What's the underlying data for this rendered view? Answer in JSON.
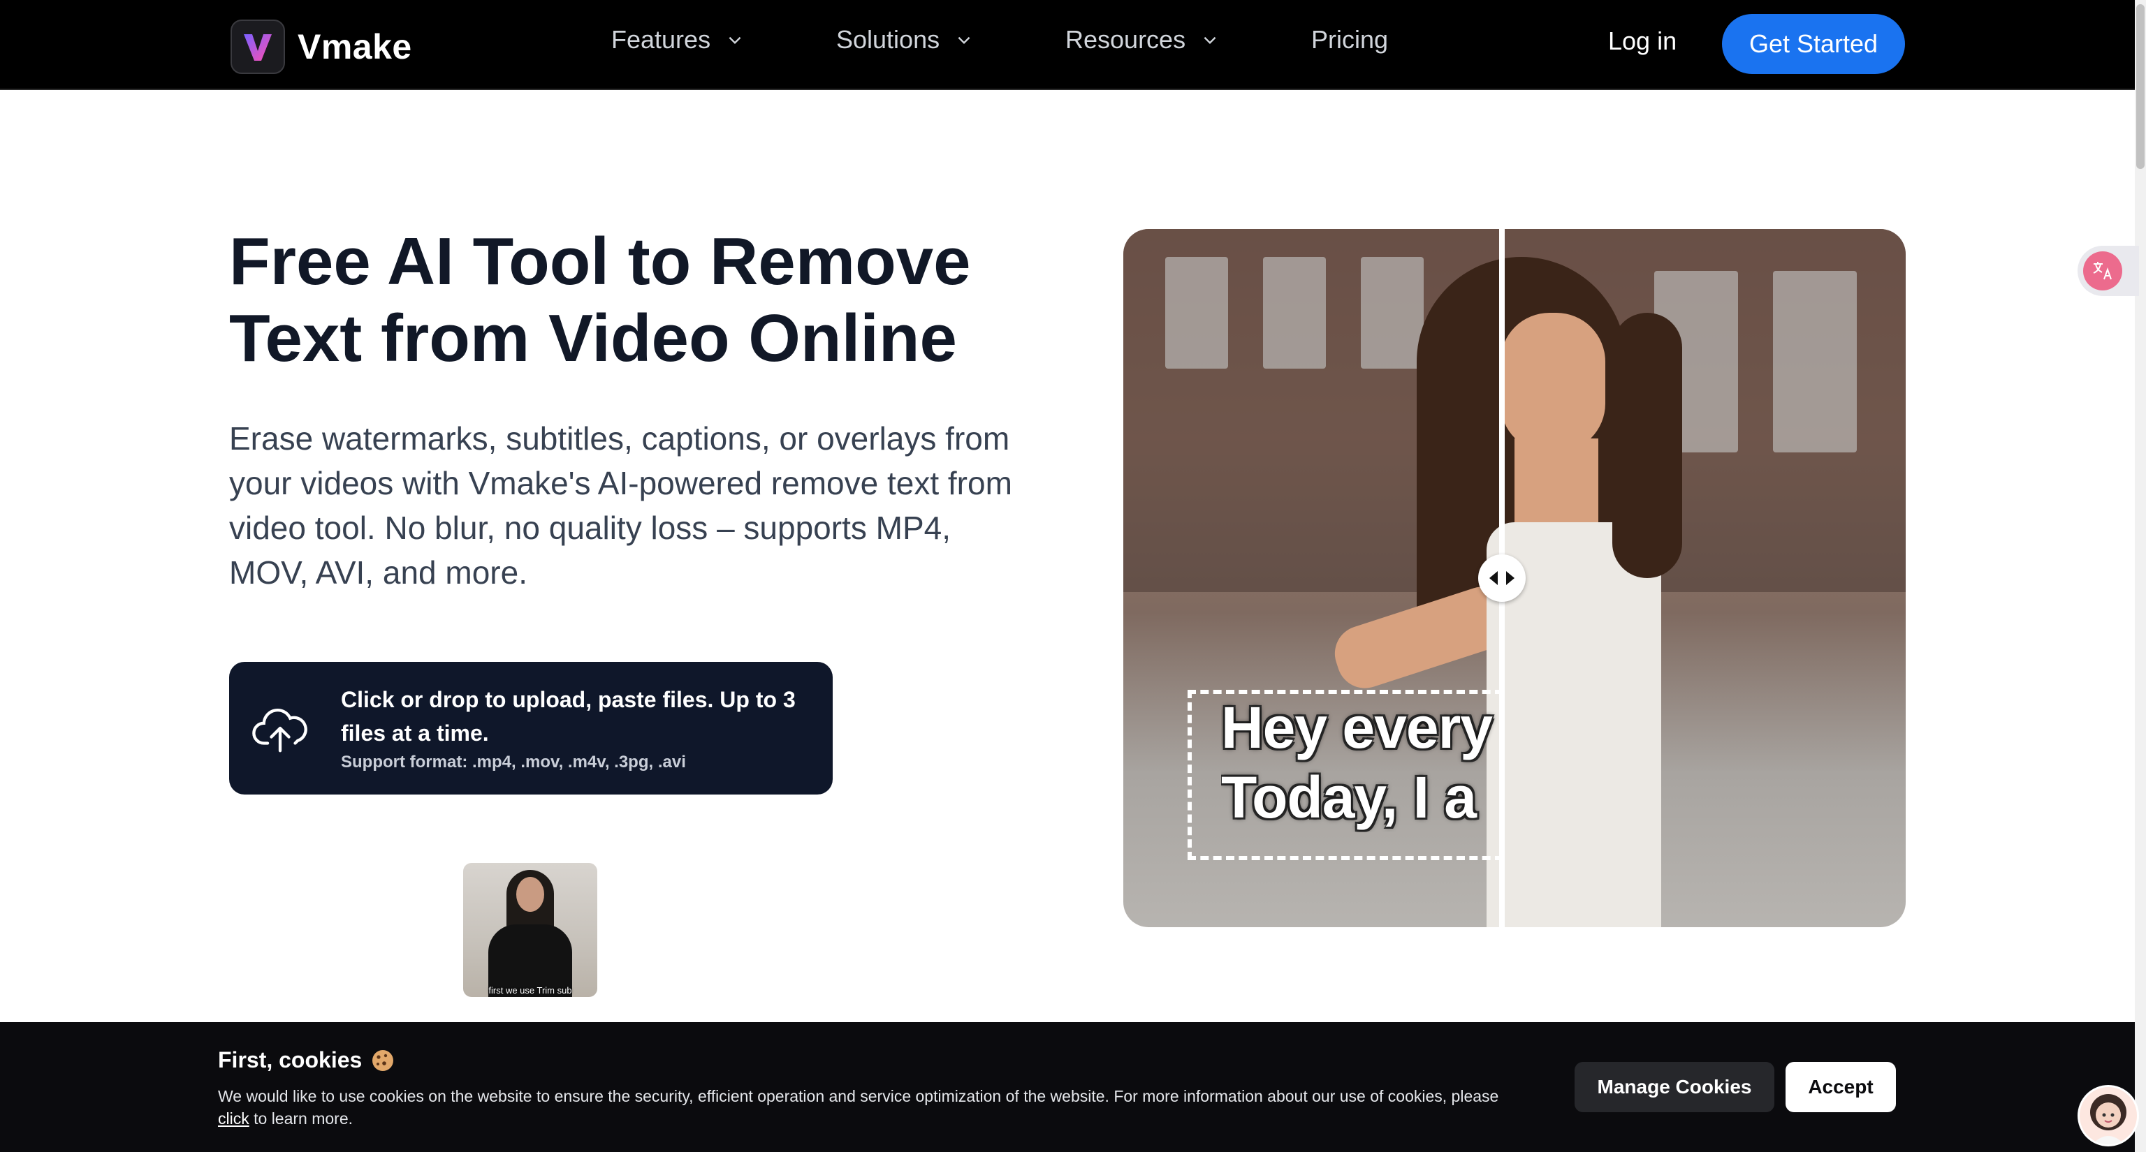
{
  "header": {
    "logo_text": "Vmake",
    "nav": [
      {
        "label": "Features"
      },
      {
        "label": "Solutions"
      },
      {
        "label": "Resources"
      },
      {
        "label": "Pricing"
      }
    ],
    "login_label": "Log in",
    "cta_label": "Get Started"
  },
  "hero": {
    "title": "Free AI Tool to Remove Text from Video Online",
    "description": "Erase watermarks, subtitles, captions, or overlays from your videos with Vmake's AI-powered remove text from video tool. No blur, no quality loss – supports MP4, MOV, AVI, and more.",
    "upload": {
      "main_text": "Click or drop to upload, paste files. Up to 3 files at a time.",
      "formats_text": "Support format: .mp4, .mov, .m4v, .3pg, .avi"
    },
    "sample_caption": "first we use Trim sub"
  },
  "compare": {
    "overlay_line1": "Hey every",
    "overlay_line2": "Today, I a"
  },
  "cookie": {
    "title": "First, cookies",
    "text_before_link": "We would like to use cookies on the website to ensure the security, efficient operation and service optimization of the website. For more information about our use of cookies, please ",
    "link_text": "click",
    "text_after_link": " to learn more.",
    "manage_label": "Manage Cookies",
    "accept_label": "Accept"
  },
  "colors": {
    "header_bg": "#000000",
    "cta_blue": "#1a73f0",
    "upload_bg": "#0f172a",
    "cookie_bg": "#0b0b0e"
  }
}
